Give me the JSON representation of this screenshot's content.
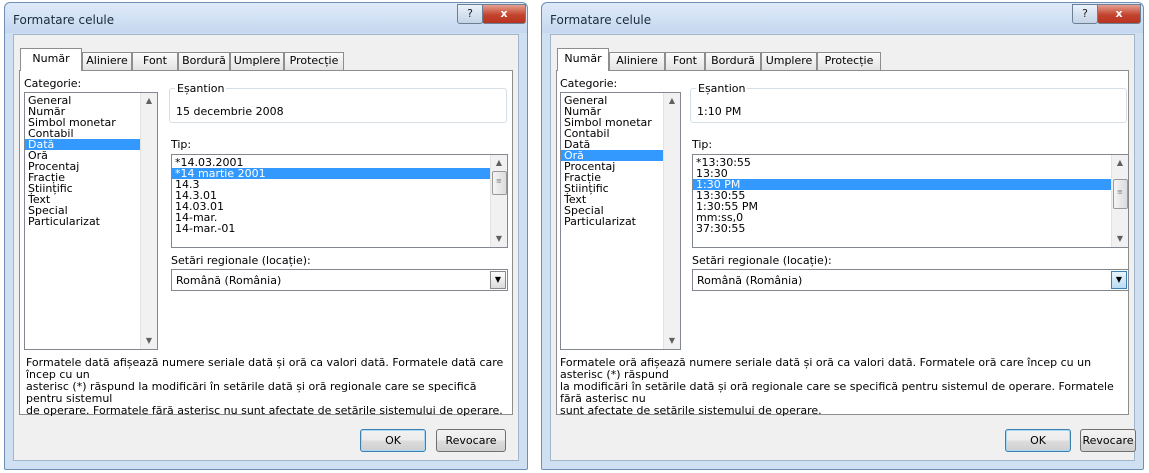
{
  "dialogs": [
    {
      "title": "Formatare celule",
      "help_label": "?",
      "close_label": "x",
      "tabs": [
        "Număr",
        "Aliniere",
        "Font",
        "Bordură",
        "Umplere",
        "Protecție"
      ],
      "active_tab": "Număr",
      "category": {
        "label": "Categorie:",
        "items": [
          "General",
          "Număr",
          "Simbol monetar",
          "Contabil",
          "Dată",
          "Oră",
          "Procentaj",
          "Fracție",
          "Științific",
          "Text",
          "Special",
          "Particularizat"
        ],
        "selected": "Dată"
      },
      "sample": {
        "label": "Eșantion",
        "value": "15 decembrie 2008"
      },
      "type": {
        "label": "Tip:",
        "items": [
          "*14.03.2001",
          "*14 martie 2001",
          "14.3",
          "14.3.01",
          "14.03.01",
          "14-mar.",
          "14-mar.-01"
        ],
        "selected": "*14 martie 2001"
      },
      "locale": {
        "label": "Setări regionale (locație):",
        "value": "Română (România)"
      },
      "description": [
        "Formatele dată afișează numere seriale dată și oră ca valori dată. Formatele dată care încep cu un",
        "asterisc (*) răspund la modificări în setările dată și oră regionale care se specifică pentru sistemul",
        "de operare. Formatele fără asterisc nu sunt afectate de setările sistemului de operare."
      ],
      "ok_label": "OK",
      "cancel_label": "Revocare"
    },
    {
      "title": "Formatare celule",
      "help_label": "?",
      "close_label": "x",
      "tabs": [
        "Număr",
        "Aliniere",
        "Font",
        "Bordură",
        "Umplere",
        "Protecție"
      ],
      "active_tab": "Număr",
      "category": {
        "label": "Categorie:",
        "items": [
          "General",
          "Număr",
          "Simbol monetar",
          "Contabil",
          "Dată",
          "Oră",
          "Procentaj",
          "Fracție",
          "Științific",
          "Text",
          "Special",
          "Particularizat"
        ],
        "selected": "Oră"
      },
      "sample": {
        "label": "Eșantion",
        "value": "1:10 PM"
      },
      "type": {
        "label": "Tip:",
        "items": [
          "*13:30:55",
          "13:30",
          "1:30 PM",
          "13:30:55",
          "1:30:55 PM",
          "mm:ss,0",
          "37:30:55"
        ],
        "selected": "1:30 PM"
      },
      "locale": {
        "label": "Setări regionale (locație):",
        "value": "Română (România)"
      },
      "description": [
        "Formatele oră afișează numere seriale dată și oră ca valori dată. Formatele oră care încep cu un asterisc (*) răspund",
        "la modificări în setările dată și oră regionale care se specifică pentru sistemul de operare. Formatele fără asterisc nu",
        "sunt afectate de setările sistemului de operare."
      ],
      "ok_label": "OK",
      "cancel_label": "Revocare"
    }
  ]
}
